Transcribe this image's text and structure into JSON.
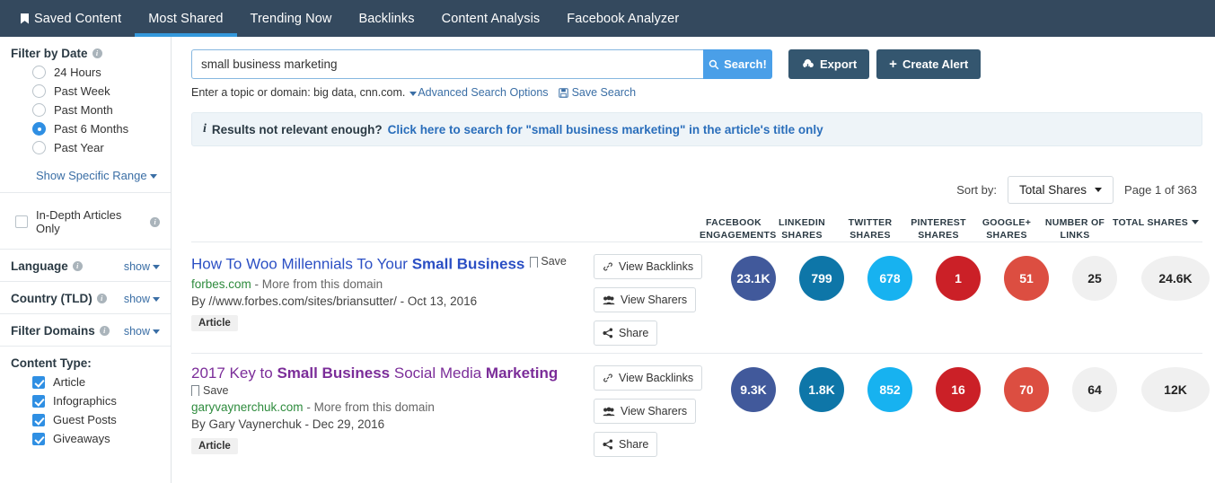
{
  "navbar": {
    "items": [
      {
        "label": "Saved Content",
        "icon": "bookmark-icon",
        "active": false
      },
      {
        "label": "Most Shared",
        "active": true
      },
      {
        "label": "Trending Now",
        "active": false
      },
      {
        "label": "Backlinks",
        "active": false
      },
      {
        "label": "Content Analysis",
        "active": false
      },
      {
        "label": "Facebook Analyzer",
        "active": false
      }
    ],
    "background": "#34495e",
    "active_underline": "#3498db"
  },
  "sidebar": {
    "date_filter": {
      "title": "Filter by Date",
      "options": [
        {
          "label": "24 Hours",
          "selected": false
        },
        {
          "label": "Past Week",
          "selected": false
        },
        {
          "label": "Past Month",
          "selected": false
        },
        {
          "label": "Past 6 Months",
          "selected": true
        },
        {
          "label": "Past Year",
          "selected": false
        }
      ],
      "range_link": "Show Specific Range"
    },
    "in_depth": {
      "label": "In-Depth Articles Only",
      "checked": false
    },
    "collapsible": [
      {
        "title": "Language",
        "toggle": "show"
      },
      {
        "title": "Country (TLD)",
        "toggle": "show"
      },
      {
        "title": "Filter Domains",
        "toggle": "show"
      }
    ],
    "content_type": {
      "title": "Content Type:",
      "options": [
        {
          "label": "Article",
          "checked": true
        },
        {
          "label": "Infographics",
          "checked": true
        },
        {
          "label": "Guest Posts",
          "checked": true
        },
        {
          "label": "Giveaways",
          "checked": true
        }
      ]
    }
  },
  "search": {
    "value": "small business marketing",
    "placeholder": "Enter a topic or domain",
    "search_button": "Search!",
    "export_button": "Export",
    "create_alert_button": "Create Alert",
    "hint_text": "Enter a topic or domain: big data, cnn.com.",
    "advanced_link": "Advanced Search Options",
    "save_search_link": "Save Search"
  },
  "alert": {
    "prefix": "Results not relevant enough?",
    "link": "Click here to search for \"small business marketing\" in the article's title only"
  },
  "toolbar": {
    "sort_label": "Sort by:",
    "sort_value": "Total Shares",
    "page_info": "Page 1 of 363"
  },
  "columns": [
    {
      "line1": "FACEBOOK",
      "line2": "ENGAGEMENTS"
    },
    {
      "line1": "LINKEDIN",
      "line2": "SHARES"
    },
    {
      "line1": "TWITTER",
      "line2": "SHARES"
    },
    {
      "line1": "PINTEREST",
      "line2": "SHARES"
    },
    {
      "line1": "GOOGLE+",
      "line2": "SHARES"
    },
    {
      "line1": "NUMBER OF",
      "line2": "LINKS"
    },
    {
      "line1": "TOTAL SHARES",
      "line2": ""
    }
  ],
  "actions": {
    "backlinks": "View Backlinks",
    "sharers": "View Sharers",
    "share": "Share",
    "save": "Save",
    "more_from_domain": "More from this domain"
  },
  "results": [
    {
      "title_parts": [
        {
          "text": "How To Woo Millennials To Your ",
          "bold": false
        },
        {
          "text": "Small Business",
          "bold": true
        }
      ],
      "title_plain": "How To Woo Millennials To Your Small Business",
      "visited": false,
      "save_inline": true,
      "domain": "forbes.com",
      "byline": "By //www.forbes.com/sites/briansutter/ - Oct 13, 2016",
      "badge": "Article",
      "metrics": {
        "facebook": "23.1K",
        "linkedin": "799",
        "twitter": "678",
        "pinterest": "1",
        "googleplus": "51",
        "links": "25",
        "total": "24.6K"
      }
    },
    {
      "title_parts": [
        {
          "text": "2017 Key to ",
          "bold": false
        },
        {
          "text": "Small Business",
          "bold": true
        },
        {
          "text": " Social Media ",
          "bold": false
        },
        {
          "text": "Marketing",
          "bold": true
        }
      ],
      "title_plain": "2017 Key to Small Business Social Media Marketing",
      "visited": true,
      "save_inline": false,
      "domain": "garyvaynerchuk.com",
      "byline": "By Gary Vaynerchuk - Dec 29, 2016",
      "badge": "Article",
      "metrics": {
        "facebook": "9.3K",
        "linkedin": "1.8K",
        "twitter": "852",
        "pinterest": "16",
        "googleplus": "70",
        "links": "64",
        "total": "12K"
      }
    }
  ],
  "colors": {
    "facebook": "#41599b",
    "linkedin": "#0e76a8",
    "twitter": "#17b2f0",
    "pinterest": "#cb2027",
    "googleplus": "#dc4e41",
    "neutral": "#f0f0f0"
  }
}
